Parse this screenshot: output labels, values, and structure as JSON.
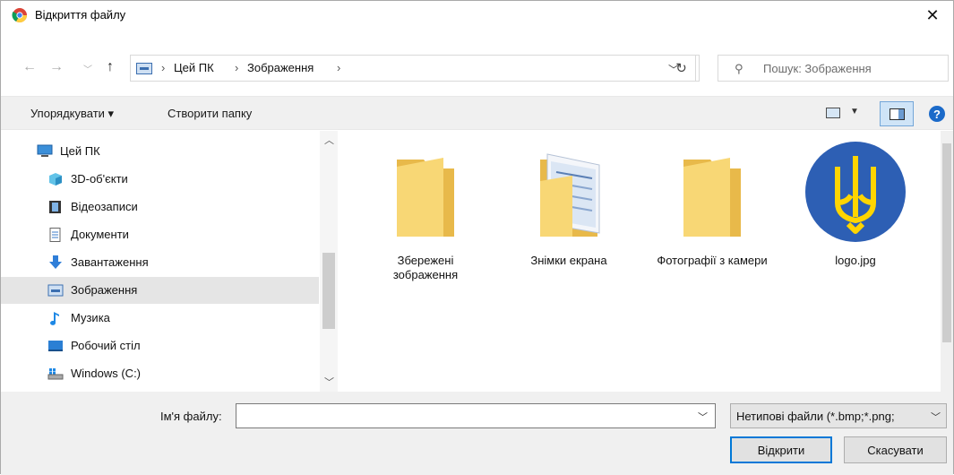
{
  "window": {
    "title": "Відкриття файлу",
    "close_label": "✕"
  },
  "nav": {
    "back_icon": "arrow-left-icon",
    "forward_icon": "arrow-right-icon",
    "recent_icon": "chevron-down-icon",
    "up_icon": "arrow-up-icon"
  },
  "address": {
    "crumbs": [
      "Цей ПК",
      "Зображення"
    ],
    "separator": "›"
  },
  "search": {
    "placeholder": "Пошук: Зображення"
  },
  "toolbar": {
    "organize_label": "Упорядкувати ▾",
    "new_folder_label": "Створити папку",
    "help_label": "?"
  },
  "sidebar": {
    "items": [
      {
        "label": "Цей ПК",
        "icon": "computer-icon"
      },
      {
        "label": "3D-об'єкти",
        "icon": "cube-3d-icon"
      },
      {
        "label": "Відеозаписи",
        "icon": "video-film-icon"
      },
      {
        "label": "Документи",
        "icon": "document-icon"
      },
      {
        "label": "Завантаження",
        "icon": "download-arrow-icon"
      },
      {
        "label": "Зображення",
        "icon": "pictures-icon",
        "selected": true
      },
      {
        "label": "Музика",
        "icon": "music-note-icon"
      },
      {
        "label": "Робочий стіл",
        "icon": "desktop-icon"
      },
      {
        "label": "Windows (C:)",
        "icon": "drive-icon"
      }
    ]
  },
  "files": [
    {
      "label": "Збережені зображення",
      "type": "folder"
    },
    {
      "label": "Знімки екрана",
      "type": "folder-with-documents"
    },
    {
      "label": "Фотографії з камери",
      "type": "folder"
    },
    {
      "label": "logo.jpg",
      "type": "image-trident"
    }
  ],
  "bottom": {
    "filename_label": "Ім'я файлу:",
    "filename_value": "",
    "filetype_value": "Нетипові файли (*.bmp;*.png;",
    "open_label": "Відкрити",
    "cancel_label": "Скасувати"
  },
  "colors": {
    "accent": "#0078d7",
    "folder": "#f8d775",
    "logo_bg": "#2d5fb4",
    "logo_fg": "#ffd500"
  }
}
